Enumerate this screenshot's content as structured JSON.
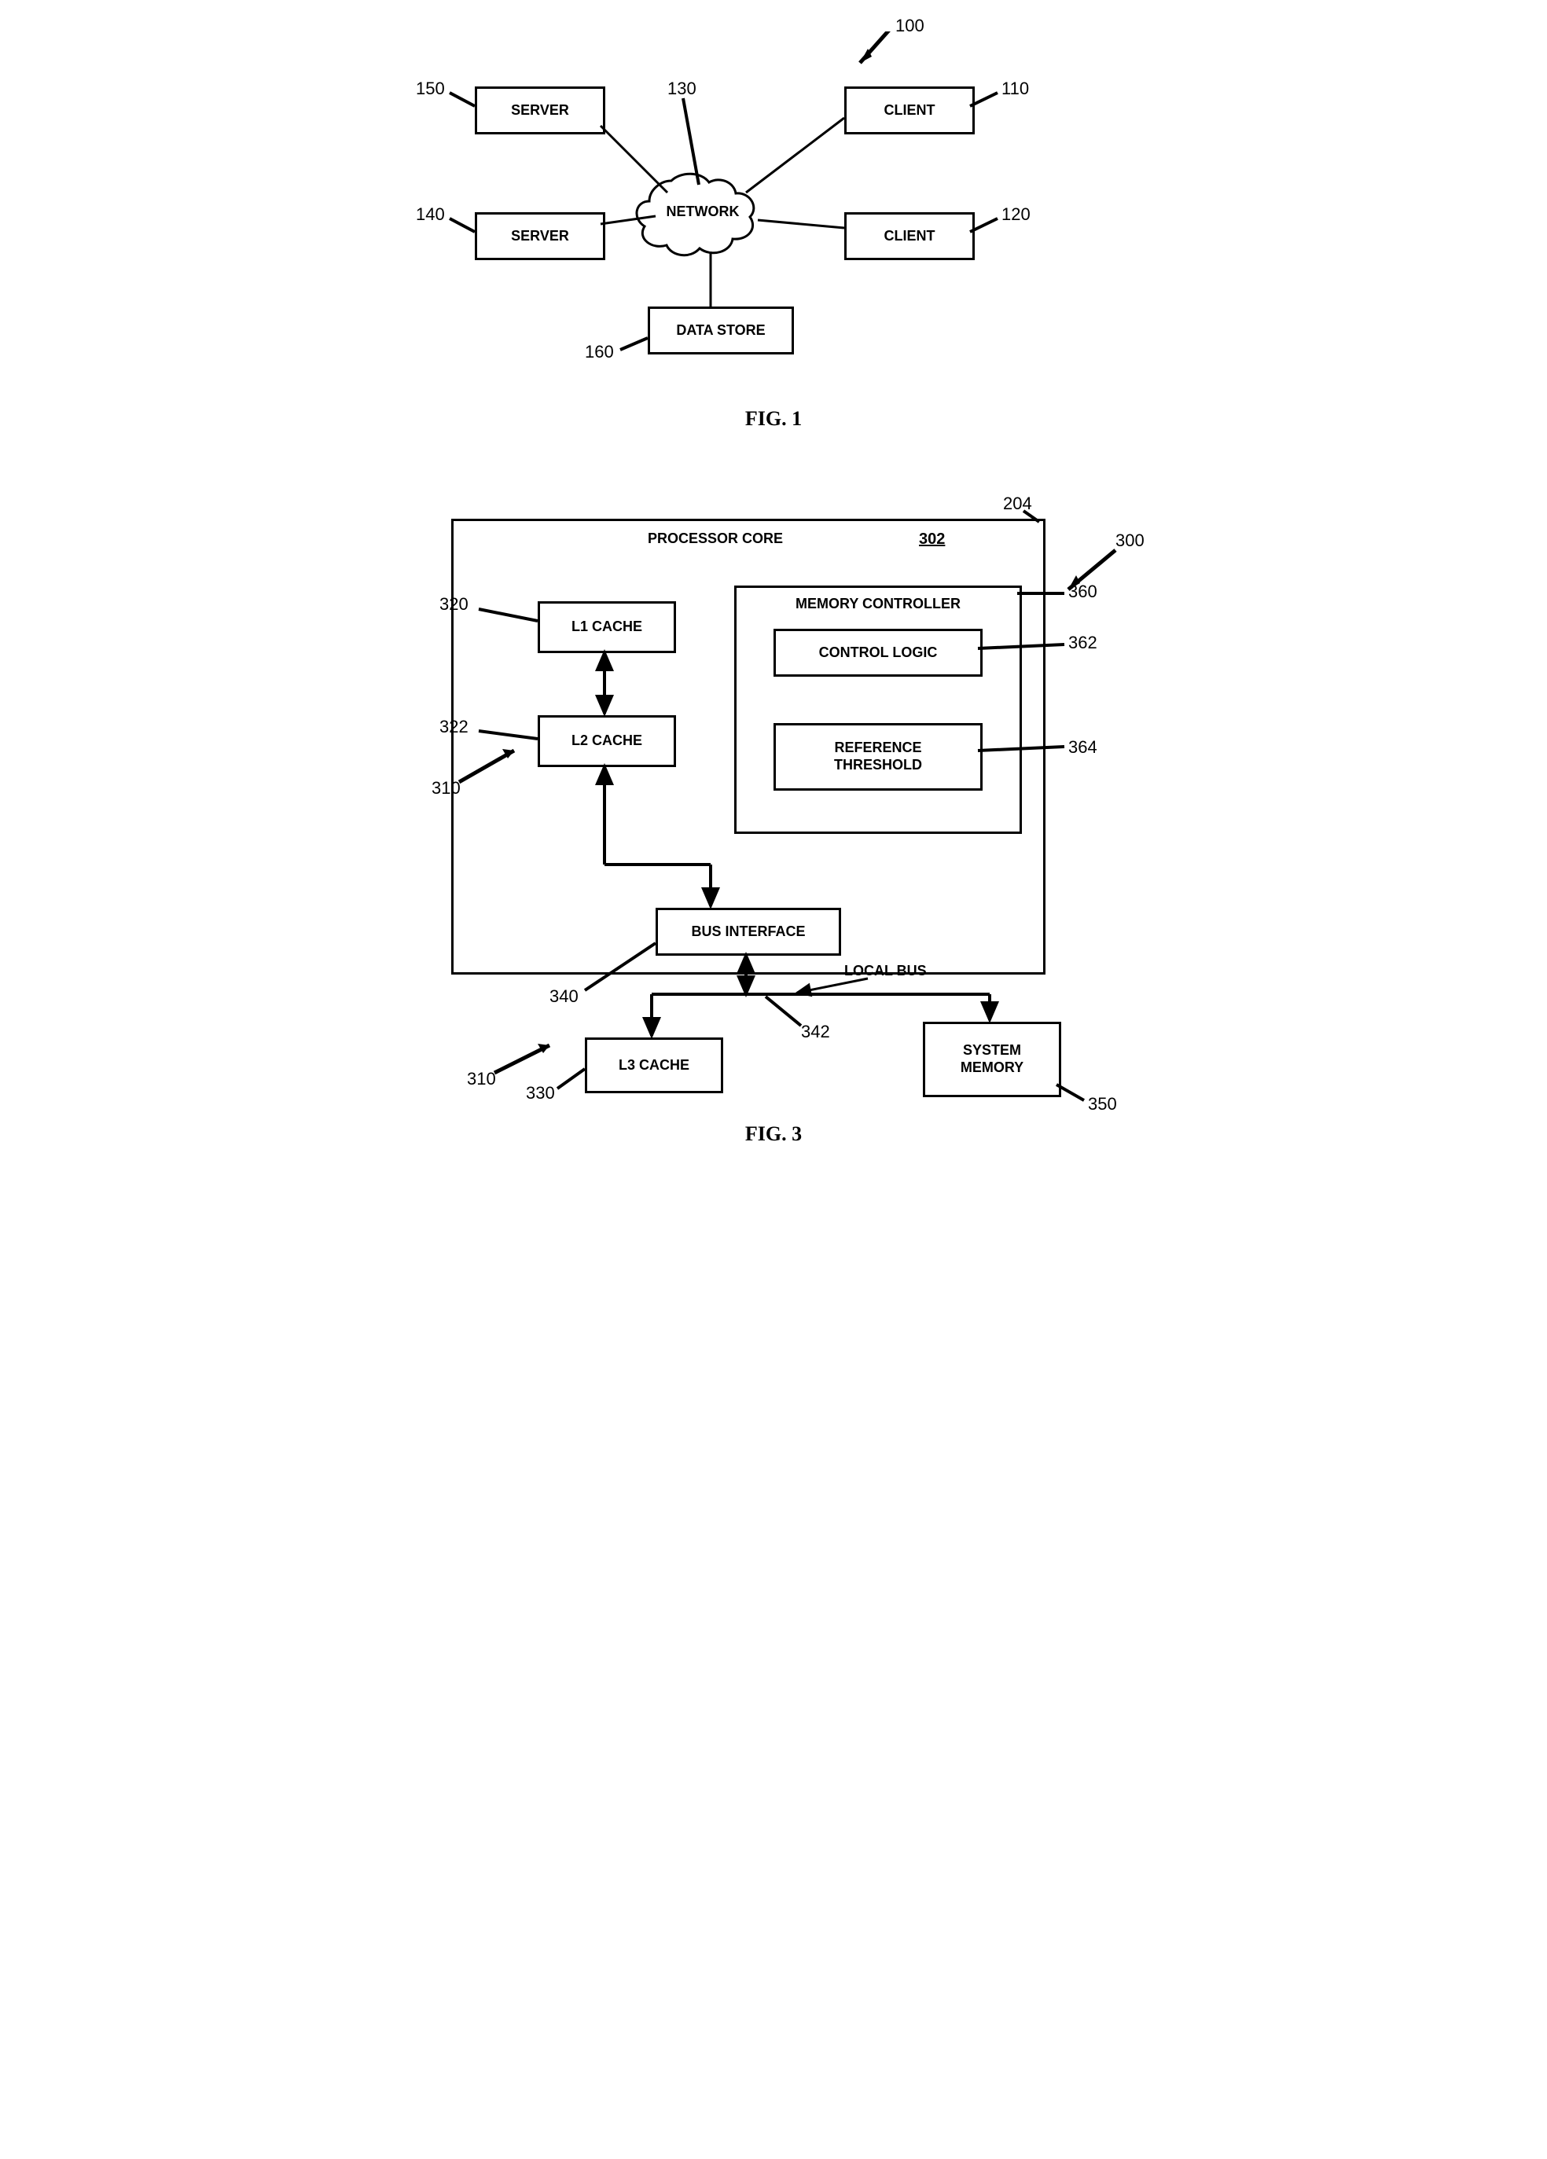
{
  "fig1": {
    "caption": "FIG. 1",
    "labels": {
      "ref100": "100",
      "ref110": "110",
      "ref120": "120",
      "ref130": "130",
      "ref140": "140",
      "ref150": "150",
      "ref160": "160"
    },
    "nodes": {
      "network": "NETWORK",
      "client_top": "CLIENT",
      "client_bottom": "CLIENT",
      "server_top": "SERVER",
      "server_bottom": "SERVER",
      "data_store": "DATA STORE"
    }
  },
  "fig3": {
    "caption": "FIG. 3",
    "labels": {
      "ref204": "204",
      "ref300": "300",
      "ref302": "302",
      "ref310a": "310",
      "ref310b": "310",
      "ref320": "320",
      "ref322": "322",
      "ref330": "330",
      "ref340": "340",
      "ref342": "342",
      "ref350": "350",
      "ref360": "360",
      "ref362": "362",
      "ref364": "364"
    },
    "nodes": {
      "processor_core": "PROCESSOR CORE",
      "l1_cache": "L1 CACHE",
      "l2_cache": "L2 CACHE",
      "l3_cache": "L3 CACHE",
      "memory_controller": "MEMORY CONTROLLER",
      "control_logic": "CONTROL LOGIC",
      "reference_threshold": "REFERENCE\nTHRESHOLD",
      "bus_interface": "BUS INTERFACE",
      "local_bus": "LOCAL BUS",
      "system_memory": "SYSTEM\nMEMORY"
    }
  }
}
